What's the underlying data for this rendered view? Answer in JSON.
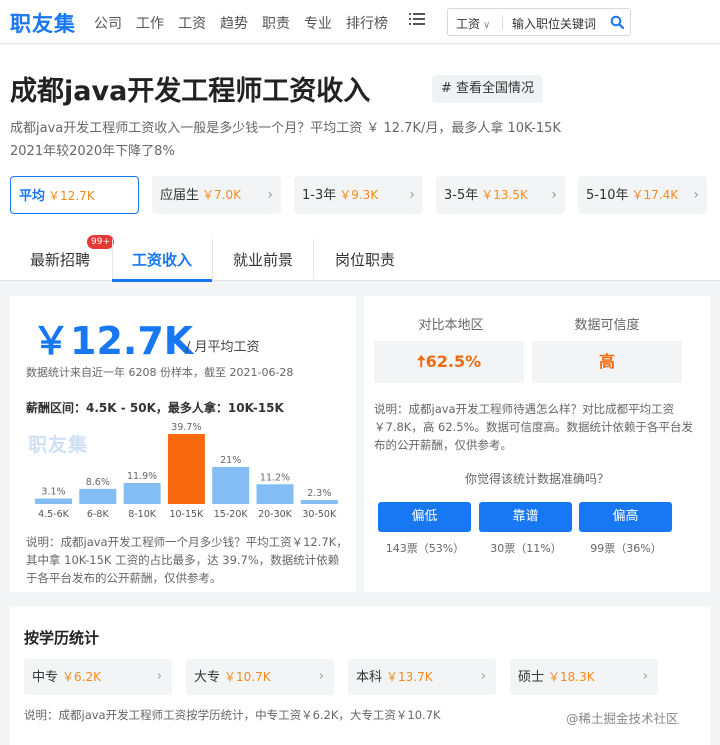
{
  "app": {
    "logo": "职友集"
  },
  "nav": [
    "公司",
    "工作",
    "工资",
    "趋势",
    "职责",
    "专业",
    "排行榜"
  ],
  "search": {
    "select": "工资",
    "placeholder": "输入职位关键词"
  },
  "header": {
    "title": "成都java开发工程师工资收入",
    "tag": "# 查看全国情况",
    "desc_line1": "成都java开发工程师工资收入一般是多少钱一个月？平均工资 ￥ 12.7K/月，最多人拿 10K-15K",
    "desc_line2": "2021年较2020年下降了8%"
  },
  "pills": [
    {
      "label": "平均",
      "value": "￥12.7K"
    },
    {
      "label": "应届生",
      "value": "￥7.0K"
    },
    {
      "label": "1-3年",
      "value": "￥9.3K"
    },
    {
      "label": "3-5年",
      "value": "￥13.5K"
    },
    {
      "label": "5-10年",
      "value": "￥17.4K"
    }
  ],
  "tabs": [
    "最新招聘",
    "工资收入",
    "就业前景",
    "岗位职责"
  ],
  "tab_badge": "99+",
  "salary": {
    "big": "￥12.7K",
    "unit": "/ 月平均工资",
    "sample": "数据统计来自近一年 6208 份样本，截至 2021-06-28",
    "range": "薪酬区间：4.5K - 50K，最多人拿：10K-15K",
    "watermark": "职友集",
    "note": "说明：成都java开发工程师一个月多少钱？平均工资￥12.7K，其中拿 10K-15K 工资的占比最多，达 39.7%，数据统计依赖于各平台发布的公开薪酬，仅供参考。"
  },
  "chart_data": {
    "type": "bar",
    "categories": [
      "4.5-6K",
      "6-8K",
      "8-10K",
      "10-15K",
      "15-20K",
      "20-30K",
      "30-50K"
    ],
    "values": [
      3.1,
      8.6,
      11.9,
      39.7,
      21,
      11.2,
      2.3
    ],
    "labels": [
      "3.1%",
      "8.6%",
      "11.9%",
      "39.7%",
      "21%",
      "11.2%",
      "2.3%"
    ],
    "highlight_index": 3,
    "colors": {
      "normal": "#84bdf3",
      "highlight": "#f96a10"
    }
  },
  "compare": {
    "label1": "对比本地区",
    "value1": "62.5%",
    "label2": "数据可信度",
    "value2": "高",
    "note": "说明：成都java开发工程师待遇怎么样？对比成都平均工资 ￥7.8K，高 62.5%。数据可信度高。数据统计依赖于各平台发布的公开薪酬，仅供参考。",
    "question": "你觉得该统计数据准确吗？",
    "votes": [
      {
        "label": "偏低",
        "count": "143票（53%）"
      },
      {
        "label": "靠谱",
        "count": "30票（11%）"
      },
      {
        "label": "偏高",
        "count": "99票（36%）"
      }
    ]
  },
  "edu": {
    "title": "按学历统计",
    "items": [
      {
        "label": "中专",
        "value": "￥6.2K"
      },
      {
        "label": "大专",
        "value": "￥10.7K"
      },
      {
        "label": "本科",
        "value": "￥13.7K"
      },
      {
        "label": "硕士",
        "value": "￥18.3K"
      }
    ],
    "note": "说明：成都java开发工程师工资按学历统计，中专工资￥6.2K，大专工资￥10.7K"
  },
  "footer": "@稀土掘金技术社区",
  "colors": {
    "accent": "#1877f2",
    "orange": "#f28b1e"
  }
}
